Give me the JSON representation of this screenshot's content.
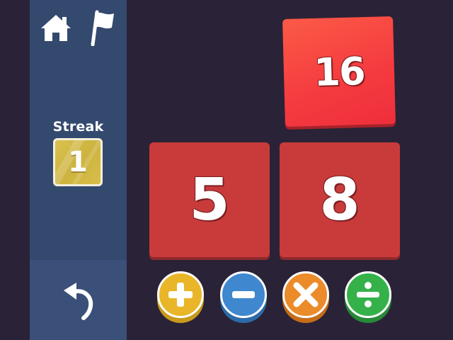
{
  "sidebar": {
    "home_icon": "home-icon",
    "flag_icon": "flag-icon",
    "undo_icon": "undo-icon",
    "streak_label": "Streak",
    "streak_value": "1"
  },
  "target": {
    "value": "16"
  },
  "numbers": [
    {
      "value": "5"
    },
    {
      "value": "8"
    }
  ],
  "operators": [
    {
      "name": "plus",
      "icon": "plus-icon",
      "color": "#e9b62a"
    },
    {
      "name": "minus",
      "icon": "minus-icon",
      "color": "#3f87cf"
    },
    {
      "name": "times",
      "icon": "times-icon",
      "color": "#ec8b2a"
    },
    {
      "name": "divide",
      "icon": "divide-icon",
      "color": "#35b14a"
    }
  ],
  "colors": {
    "background": "#2a2236",
    "sidebar": "#34496e",
    "target_tile": "#f53a3f",
    "number_tile": "#c93b3b",
    "streak_badge": "#d4bc46"
  }
}
